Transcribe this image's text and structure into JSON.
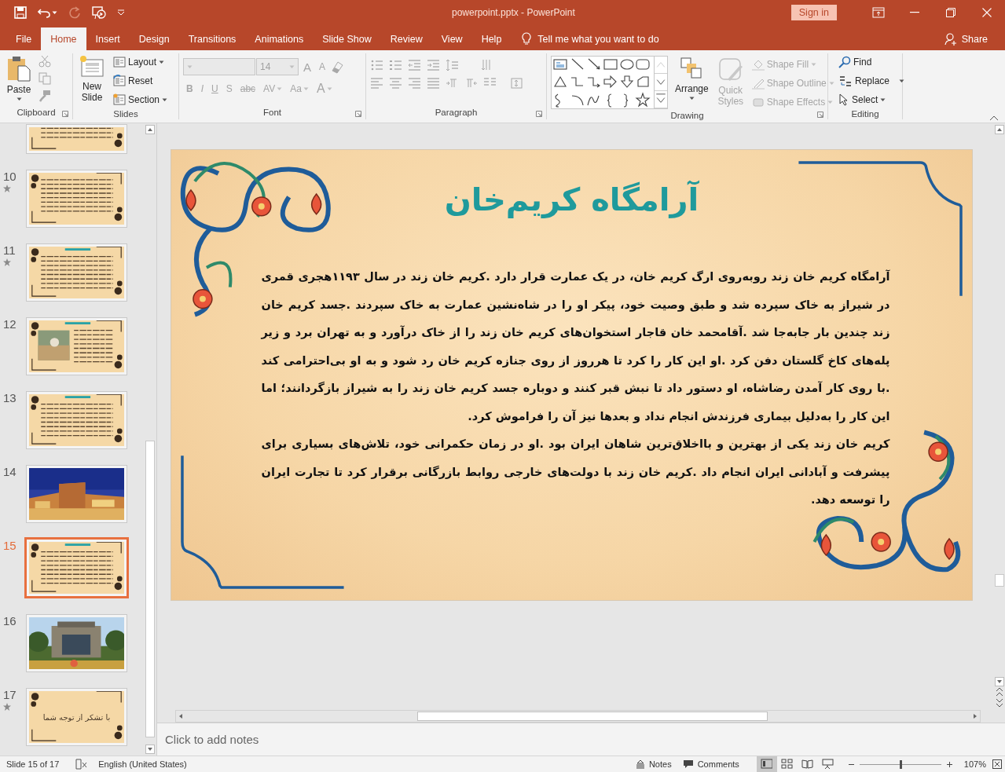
{
  "window": {
    "title": "powerpoint.pptx  -  PowerPoint",
    "sign_in": "Sign in"
  },
  "tabs": [
    {
      "label": "File",
      "selected": false
    },
    {
      "label": "Home",
      "selected": true
    },
    {
      "label": "Insert",
      "selected": false
    },
    {
      "label": "Design",
      "selected": false
    },
    {
      "label": "Transitions",
      "selected": false
    },
    {
      "label": "Animations",
      "selected": false
    },
    {
      "label": "Slide Show",
      "selected": false
    },
    {
      "label": "Review",
      "selected": false
    },
    {
      "label": "View",
      "selected": false
    },
    {
      "label": "Help",
      "selected": false
    }
  ],
  "tell_me": "Tell me what you want to do",
  "share": "Share",
  "ribbon": {
    "groups": [
      {
        "label": "Clipboard",
        "items": [
          {
            "label": "Paste"
          }
        ]
      },
      {
        "label": "Slides",
        "items": [
          {
            "label": "New Slide"
          },
          {
            "label": "Layout"
          },
          {
            "label": "Reset"
          },
          {
            "label": "Section"
          }
        ]
      },
      {
        "label": "Font",
        "font_size": "14",
        "size_buttons": [
          "A",
          "A"
        ],
        "format_buttons": [
          "B",
          "I",
          "U",
          "S",
          "abc",
          "AV",
          "Aa",
          "A"
        ]
      },
      {
        "label": "Paragraph"
      },
      {
        "label": "Drawing",
        "items": [
          {
            "label": "Arrange",
            "disabled": false
          },
          {
            "label": "Quick Styles",
            "disabled": true
          },
          {
            "label": "Shape Fill",
            "disabled": true
          },
          {
            "label": "Shape Outline",
            "disabled": true
          },
          {
            "label": "Shape Effects",
            "disabled": true
          }
        ]
      },
      {
        "label": "Editing",
        "items": [
          {
            "label": "Find"
          },
          {
            "label": "Replace"
          },
          {
            "label": "Select"
          }
        ]
      }
    ]
  },
  "slides_pane": {
    "thumbnails": [
      {
        "kind": "text",
        "partial": true,
        "selected": false
      },
      {
        "number": "10",
        "kind": "text",
        "partial": false,
        "selected": false,
        "starred": true
      },
      {
        "number": "11",
        "kind": "titled",
        "partial": false,
        "selected": false,
        "starred": true
      },
      {
        "number": "12",
        "kind": "titled-picture",
        "partial": false,
        "selected": false,
        "starred": false
      },
      {
        "number": "13",
        "kind": "titled",
        "partial": false,
        "selected": false,
        "starred": false
      },
      {
        "number": "14",
        "kind": "picture",
        "partial": false,
        "selected": false,
        "starred": false
      },
      {
        "number": "15",
        "kind": "titled",
        "partial": false,
        "selected": true,
        "starred": false
      },
      {
        "number": "16",
        "kind": "picture",
        "partial": false,
        "selected": false,
        "starred": false
      },
      {
        "number": "17",
        "kind": "closing",
        "text": "با تشکر از توجه شما",
        "partial": false,
        "selected": false,
        "starred": true
      }
    ]
  },
  "slide": {
    "title": "آرامگاه کریم‌خان",
    "paragraphs": [
      "آرامگاه کریم خان زند روبه‌روی ارگ کریم خان، در یک عمارت قرار دارد .کریم خان زند در سال ۱۱۹۳هجری قمری در شیراز به خاک سپرده شد و طبق وصیت خود، پیکر او را در شاه‌نشین عمارت به خاک سپردند .جسد کریم خان زند چندین بار جابه‌جا شد .آقامحمد خان قاجار استخوان‌های کریم خان زند را از خاک درآورد و به تهران برد و زیر پله‌های کاخ گلستان دفن کرد .او این کار را کرد تا هرروز از روی جنازه کریم خان رد شود و به او بی‌احترامی کند .با روی کار آمدن رضاشاه، او دستور داد تا نبش قبر کنند و دوباره جسد کریم خان زند را به شیراز بازگردانند؛ اما این کار را به‌دلیل بیماری فرزندش انجام نداد و بعدها نیز آن را فراموش کرد.",
      "کریم خان زند یکی از بهترین و بااخلاق‌ترین شاهان ایران بود .او در زمان حکمرانی خود، تلاش‌های بسیاری برای پیشرفت و آبادانی ایران انجام داد .کریم خان زند با دولت‌های خارجی روابط بازرگانی برقرار کرد تا تجارت ایران را توسعه دهد."
    ]
  },
  "notes": {
    "placeholder": "Click to add notes"
  },
  "status_bar": {
    "slide_info": "Slide 15 of 17",
    "language": "English (United States)",
    "notes": "Notes",
    "comments": "Comments",
    "zoom": "107%",
    "zoom_slider": {
      "level": 0.5
    },
    "views": [
      {
        "kind": "normal",
        "selected": true
      },
      {
        "kind": "slide-sorter",
        "selected": false
      },
      {
        "kind": "reading",
        "selected": false
      },
      {
        "kind": "slideshow",
        "selected": false
      }
    ]
  }
}
